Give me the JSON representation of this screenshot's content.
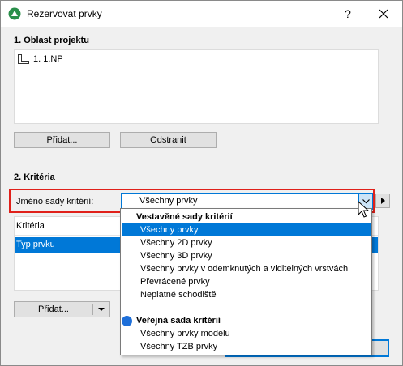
{
  "window": {
    "title": "Rezervovat prvky",
    "help_label": "?"
  },
  "project_area": {
    "heading": "1. Oblast projektu",
    "items": [
      {
        "label": "1. 1.NP",
        "icon": "story-icon"
      }
    ],
    "add_label": "Přidat...",
    "remove_label": "Odstranit"
  },
  "criteria": {
    "heading": "2. Kritéria",
    "set_name_label": "Jméno sady kritérií:",
    "selected_value": "Všechny prvky",
    "table_header": "Kritéria",
    "rows": [
      "Typ prvku"
    ],
    "add_label": "Přidat..."
  },
  "dropdown": {
    "builtin_header": "Vestavěné sady kritérií",
    "builtin_items": [
      "Všechny prvky",
      "Všechny 2D prvky",
      "Všechny 3D prvky",
      "Všechny prvky v odemknutých a viditelných vrstvách",
      "Převrácené prvky",
      "Neplatné schodiště"
    ],
    "public_header": "Veřejná sada kritérií",
    "public_items": [
      "Všechny prvky modelu",
      "Všechny TZB prvky"
    ]
  },
  "colors": {
    "accent": "#0078d7",
    "highlight_border": "#e0201a"
  }
}
